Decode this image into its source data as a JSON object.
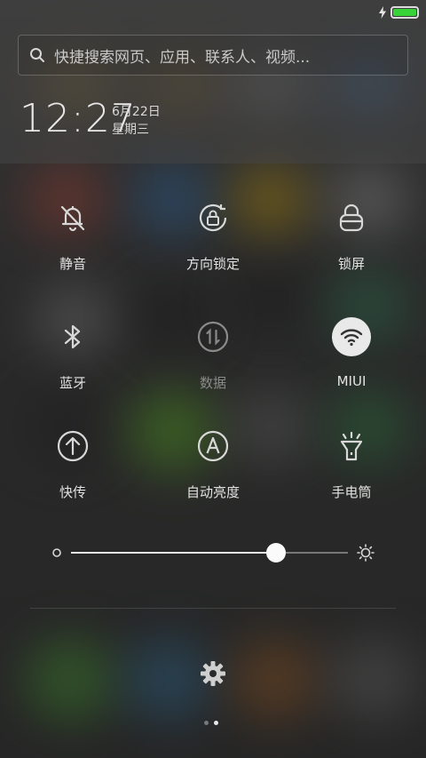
{
  "search": {
    "placeholder": "快捷搜索网页、应用、联系人、视频..."
  },
  "clock": {
    "time": "12:27",
    "date": "6月22日",
    "weekday": "星期三"
  },
  "toggles": [
    {
      "label": "静音",
      "icon": "bell-off-icon",
      "active": false
    },
    {
      "label": "方向锁定",
      "icon": "rotation-lock-icon",
      "active": false
    },
    {
      "label": "锁屏",
      "icon": "lock-icon",
      "active": false
    },
    {
      "label": "蓝牙",
      "icon": "bluetooth-icon",
      "active": false
    },
    {
      "label": "数据",
      "icon": "mobile-data-icon",
      "active": false,
      "disabled": true
    },
    {
      "label": "MIUI",
      "icon": "wifi-icon",
      "active": true
    },
    {
      "label": "快传",
      "icon": "upload-icon",
      "active": false
    },
    {
      "label": "自动亮度",
      "icon": "auto-brightness-icon",
      "active": false
    },
    {
      "label": "手电筒",
      "icon": "flashlight-icon",
      "active": false
    }
  ],
  "brightness": {
    "level": 0.74
  },
  "pager": {
    "count": 2,
    "current": 1
  },
  "colors": {
    "battery": "#38d339",
    "accent": "#e9e9e9"
  }
}
